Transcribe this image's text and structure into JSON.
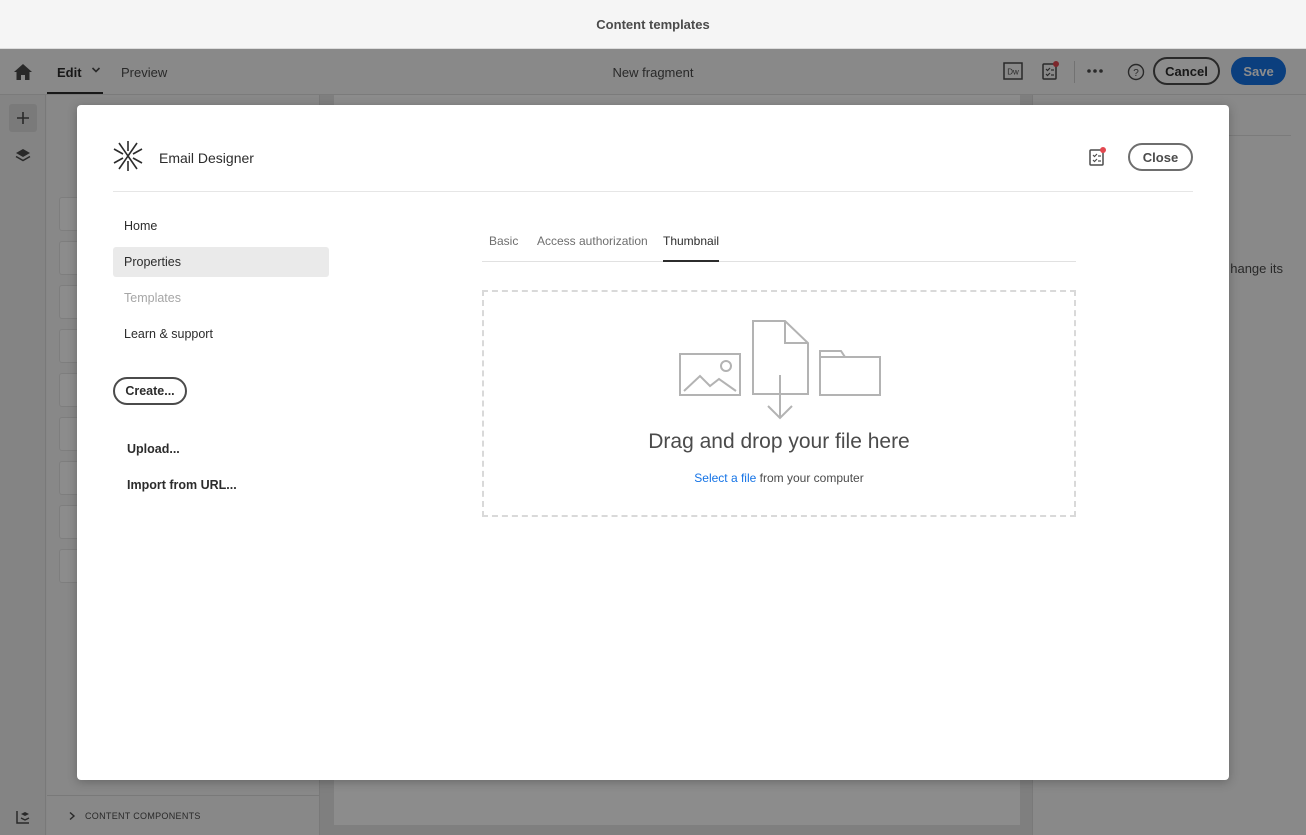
{
  "window": {
    "title": "Content templates"
  },
  "toolbar": {
    "edit_label": "Edit",
    "preview_label": "Preview",
    "document_title": "New fragment",
    "cancel_label": "Cancel",
    "save_label": "Save",
    "accent_color": "#1473e6",
    "notification_color": "#e34850"
  },
  "background": {
    "left_panel_footer": "CONTENT COMPONENTS",
    "right_panel_text": "hange its"
  },
  "modal": {
    "brand_name": "Email Designer",
    "close_label": "Close",
    "nav": [
      {
        "label": "Home",
        "state": "normal"
      },
      {
        "label": "Properties",
        "state": "active"
      },
      {
        "label": "Templates",
        "state": "disabled"
      },
      {
        "label": "Learn & support",
        "state": "normal"
      }
    ],
    "create_label": "Create...",
    "upload_label": "Upload...",
    "import_label": "Import from URL...",
    "tabs": [
      {
        "label": "Basic",
        "selected": false
      },
      {
        "label": "Access authorization",
        "selected": false
      },
      {
        "label": "Thumbnail",
        "selected": true
      }
    ],
    "dropzone": {
      "title": "Drag and drop your file here",
      "select_link": "Select a file",
      "select_suffix": " from your computer"
    }
  }
}
